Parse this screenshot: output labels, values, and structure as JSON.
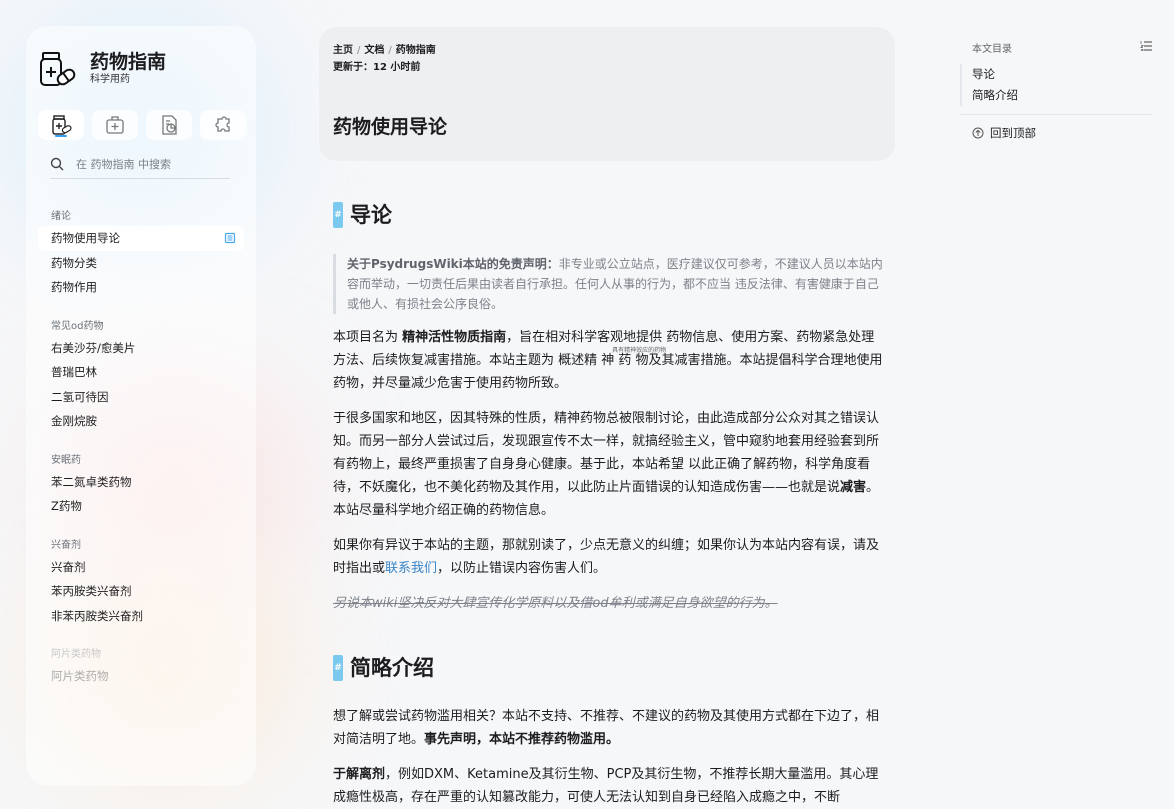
{
  "site": {
    "title": "药物指南",
    "subtitle": "科学用药"
  },
  "search": {
    "placeholder": "在 药物指南 中搜索"
  },
  "sidebar": {
    "groups": [
      {
        "label": "绪论",
        "items": [
          "药物使用导论",
          "药物分类",
          "药物作用"
        ]
      },
      {
        "label": "常见od药物",
        "items": [
          "右美沙芬/愈美片",
          "普瑞巴林",
          "二氢可待因",
          "金刚烷胺"
        ]
      },
      {
        "label": "安眠药",
        "items": [
          "苯二氮卓类药物",
          "Z药物"
        ]
      },
      {
        "label": "兴奋剂",
        "items": [
          "兴奋剂",
          "苯丙胺类兴奋剂",
          "非苯丙胺类兴奋剂"
        ]
      },
      {
        "label": "阿片类药物",
        "items": [
          "阿片类药物"
        ]
      }
    ]
  },
  "breadcrumb": {
    "home": "主页",
    "docs": "文档",
    "current": "药物指南"
  },
  "updated": "更新于：12 小时前",
  "page_title": "药物使用导论",
  "article": {
    "h_intro": "导论",
    "hash": "#",
    "quote_bold": "关于PsydrugsWiki本站的免责声明：",
    "quote_text": "非专业或公立站点，医疗建议仅可参考，不建议人员以本站内容而举动，一切责任后果由读者自行承担。任何人从事的行为，都不应当 违反法律、有害健康于自己或他人、有损社会公序良俗。",
    "p1_a": "本项目名为 ",
    "p1_b": "精神活性物质指南",
    "p1_c": "，旨在相对科学客观地提供 药物信息、使用方案、药物紧急处理方法、后续恢复减害措施。本站主题为 概述",
    "p1_ruby": "精 神 药",
    "p1_rt": "具有精神效应的药物",
    "p1_d": " 物及其减害措施。本站提倡科学合理地使用药物，并尽量减少危害于使用药物所致。",
    "p2_a": "于很多国家和地区，因其特殊的性质，精神药物总被限制讨论，由此造成部分公众对其之错误认知。而另一部分人尝试过后，发现跟宣传不太一样，就搞经验主义，管中窥豹地套用经验套到所有药物上，最终严重损害了自身身心健康。基于此，本站希望 以此正确了解药物，科学角度看待，不妖魔化，也不美化药物及其作用，以此防止片面错误的认知造成伤害——也就是说",
    "p2_b": "减害",
    "p2_c": "。本站尽量科学地介绍正确的药物信息。",
    "p3_a": "如果你有异议于本站的主题，那就别读了，少点无意义的纠缠；如果你认为本站内容有误，请及时指出或",
    "p3_link": "联系我们",
    "p3_b": "，以防止错误内容伤害人们。",
    "p4": "另说本wiki坚决反对大肆宣传化学原料以及借od牟利或满足自身欲望的行为。",
    "h_brief": "简略介绍",
    "p5_a": "想了解或尝试药物滥用相关？本站不支持、不推荐、不建议的药物及其使用方式都在下边了，相对简洁明了地。",
    "p5_b": "事先声明，本站不推荐药物滥用。",
    "p6_a": "于解离剂",
    "p6_b": "，例如DXM、Ketamine及其衍生物、PCP及其衍生物，不推荐长期大量滥用。其心理成瘾性极高，存在严重的认知篡改能力，可使人无法认知到自身已经陷入成瘾之中，不断"
  },
  "toc": {
    "title": "本文目录",
    "links": [
      "导论",
      "简略介绍"
    ],
    "back_to_top": "回到顶部"
  },
  "colors": {
    "accent": "#3aa0f0",
    "hash_bg": "#7cc9ef",
    "link": "#3a85c8"
  }
}
